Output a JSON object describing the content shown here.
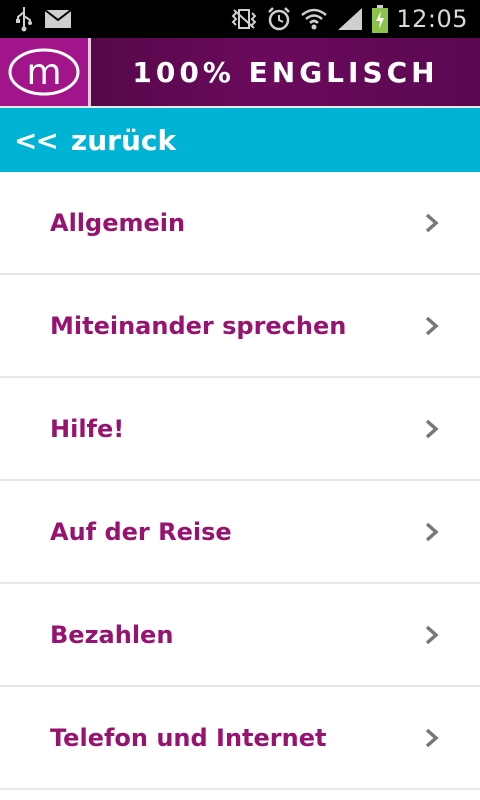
{
  "statusbar": {
    "time": "12:05",
    "icons": [
      "usb-icon",
      "mail-icon",
      "vibrate-icon",
      "alarm-icon",
      "wifi-icon",
      "signal-icon",
      "battery-charging-icon"
    ]
  },
  "header": {
    "logo_letter": "m",
    "title": "100% ENGLISCH"
  },
  "nav": {
    "back_label": "zurück",
    "back_prefix": "<<"
  },
  "menu": {
    "items": [
      {
        "label": "Allgemein"
      },
      {
        "label": "Miteinander sprechen"
      },
      {
        "label": "Hilfe!"
      },
      {
        "label": "Auf der Reise"
      },
      {
        "label": "Bezahlen"
      },
      {
        "label": "Telefon und Internet"
      }
    ]
  },
  "colors": {
    "accent": "#96146f",
    "back_bar": "#00b3d4",
    "header_bg": "#5c0a50",
    "logo_bg": "#a21489"
  }
}
